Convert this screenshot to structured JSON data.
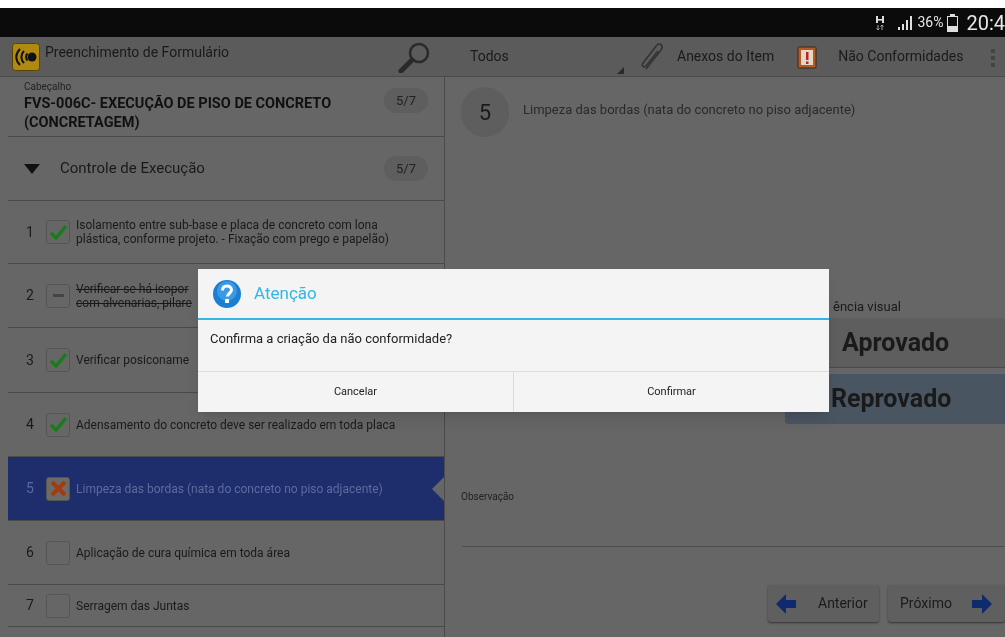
{
  "status_bar": {
    "battery": "36%",
    "time": "20:4"
  },
  "action_bar": {
    "title": "Preenchimento de Formulário",
    "filter": "Todos",
    "actions": [
      {
        "kind": "attach",
        "label": "Anexos do Item"
      },
      {
        "kind": "issues",
        "label": "Não Conformidades"
      }
    ]
  },
  "header": {
    "caption": "Cabeçalho",
    "title": "FVS-006C- EXECUÇÃO DE PISO DE CONCRETO (CONCRETAGEM)",
    "count": "5/7"
  },
  "section": {
    "title": "Controle de Execução",
    "expanded": true,
    "count": "5/7"
  },
  "items": [
    {
      "number": "1",
      "kind": "ok",
      "text": "Isolamento entre sub-base e placa de concreto com lona plástica, conforme projeto.  - Fixação com prego e papelão)",
      "selected": false
    },
    {
      "number": "2",
      "kind": "na",
      "text": "Verificar se há isopor\ncom alvenarias, pilare",
      "selected": false
    },
    {
      "number": "3",
      "kind": "ok",
      "text": "Verificar posiconame",
      "selected": false
    },
    {
      "number": "4",
      "kind": "ok",
      "text": "Adensamento do concreto deve ser realizado em toda placa",
      "selected": false
    },
    {
      "number": "5",
      "kind": "fail",
      "text": "Limpeza das bordas (nata do concreto no piso adjacente)",
      "selected": true
    },
    {
      "number": "6",
      "kind": "none",
      "text": "Aplicação de cura química em toda área",
      "selected": false
    },
    {
      "number": "7",
      "kind": "none",
      "text": "Serragem das Juntas",
      "selected": false
    }
  ],
  "detail": {
    "number": "5",
    "text": "Limpeza das bordas (nata do concreto no piso adjacente)",
    "check_label": "ência visual",
    "options": [
      {
        "label": "Aprovado",
        "selected": false
      },
      {
        "label": "Reprovado",
        "selected": true
      }
    ],
    "note_label": "Observação",
    "nav": [
      {
        "kind": "prev",
        "label": "Anterior"
      },
      {
        "kind": "next",
        "label": "Próximo"
      }
    ]
  },
  "dialog": {
    "title": "Atenção",
    "message": "Confirma a criação da não conformidade?",
    "buttons": [
      "Cancelar",
      "Confirmar"
    ]
  }
}
